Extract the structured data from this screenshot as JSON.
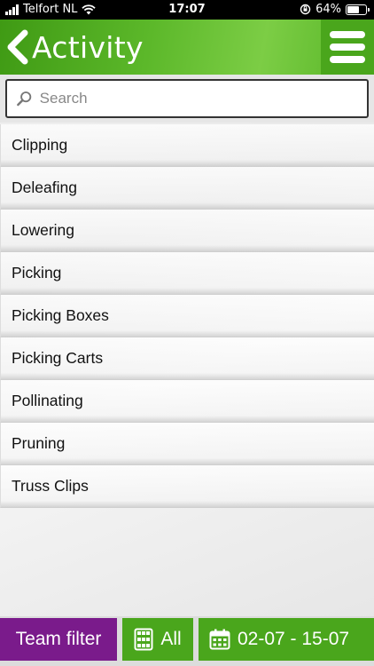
{
  "status_bar": {
    "carrier": "Telfort NL",
    "time": "17:07",
    "battery": "64%",
    "battery_level": 0.64
  },
  "header": {
    "title": "Activity",
    "back_icon": "chevron-left-icon",
    "menu_icon": "hamburger-menu-icon",
    "color": "#5cb82a"
  },
  "search": {
    "placeholder": "Search",
    "value": ""
  },
  "activities": [
    {
      "label": "Clipping"
    },
    {
      "label": "Deleafing"
    },
    {
      "label": "Lowering"
    },
    {
      "label": "Picking"
    },
    {
      "label": "Picking Boxes"
    },
    {
      "label": "Picking Carts"
    },
    {
      "label": "Pollinating"
    },
    {
      "label": "Pruning"
    },
    {
      "label": "Truss Clips"
    }
  ],
  "bottom_bar": {
    "team_filter_label": "Team filter",
    "team_filter_color": "#7a1b8b",
    "group_label": "All",
    "group_icon": "grid-icon",
    "date_range_label": "02-07 - 15-07",
    "date_icon": "calendar-icon",
    "accent_color": "#4aa61c"
  }
}
